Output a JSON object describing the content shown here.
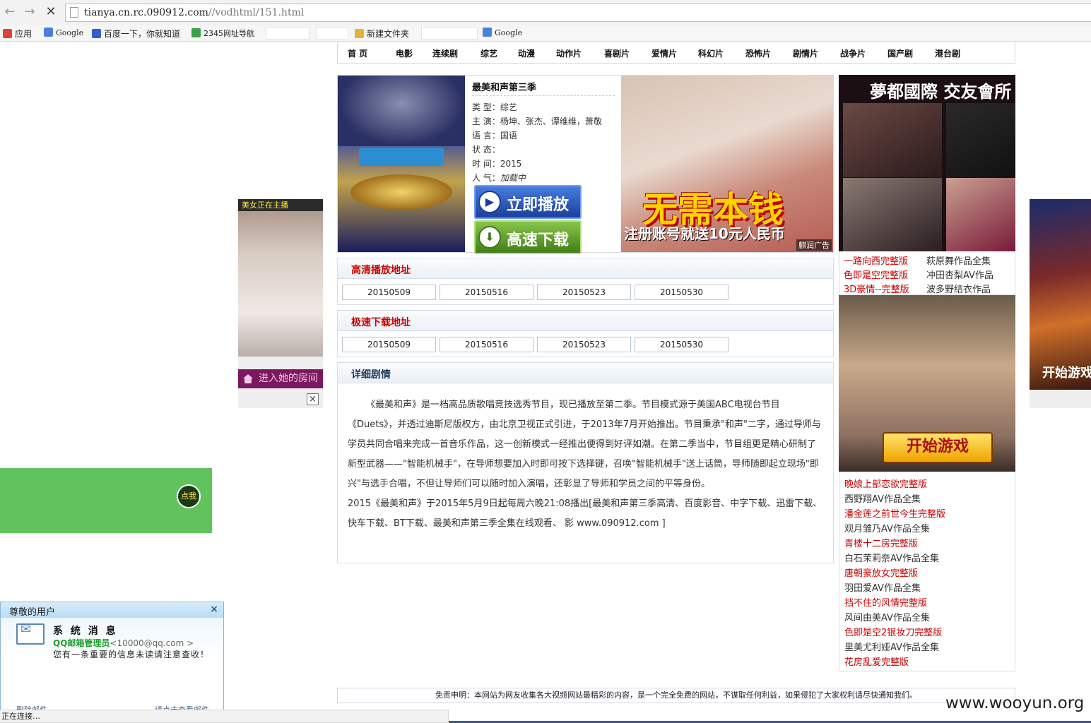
{
  "browser": {
    "url_host": "tianya.cn.rc.090912.com",
    "url_path": "//vodhtml/151.html",
    "bookmarks": [
      {
        "label": "应用",
        "color": "#d9453a"
      },
      {
        "label": "Google",
        "color": "#4a7fe0"
      },
      {
        "label": "百度一下，你就知道",
        "color": "#2f5fd0"
      },
      {
        "label": "2345网址导航",
        "color": "#3aa14a"
      },
      {
        "label": "新建文件夹",
        "color": "#e2b23a"
      },
      {
        "label": "Google",
        "color": "#4a7fe0"
      }
    ],
    "status": "正在连接…"
  },
  "nav": [
    "首 页",
    "电影",
    "连续剧",
    "综艺",
    "动漫",
    "动作片",
    "喜剧片",
    "爱情片",
    "科幻片",
    "恐怖片",
    "剧情片",
    "战争片",
    "国产剧",
    "港台剧"
  ],
  "show": {
    "title": "最美和声第三季",
    "type_label": "类 型：",
    "type": "综艺",
    "cast_label": "主 演：",
    "cast": "杨坤、张杰、谭维维，萧敬",
    "lang_label": "语 言：",
    "lang": "国语",
    "state_label": "状 态：",
    "state": "",
    "time_label": "时 间：",
    "time": "2015",
    "pop_label": "人 气：",
    "pop": "加载中",
    "play_btn": "立即播放",
    "download_btn": "高速下载"
  },
  "ad_main": {
    "headline": "无需本钱",
    "sub": "注册账号就送10元人民币",
    "tag": "麒润广告"
  },
  "play_section": {
    "title": "高清播放地址",
    "episodes": [
      "20150509",
      "20150516",
      "20150523",
      "20150530"
    ]
  },
  "download_section": {
    "title": "极速下载地址",
    "episodes": [
      "20150509",
      "20150516",
      "20150523",
      "20150530"
    ]
  },
  "detail": {
    "title": "详细剧情",
    "para1": "《最美和声》是一档高品质歌唱竞技选秀节目，现已播放至第二季。节目模式源于美国ABC电视台节目《Duets》，并透过迪斯尼版权方，由北京卫视正式引进，于2013年7月开始推出。节目秉承\"和声\"二字，通过导师与学员共同合唱来完成一首音乐作品，这一创新模式一经推出便得到好评如潮。在第二季当中，节目组更是精心研制了新型武器——\"智能机械手\"，在导师想要加入时即可按下选择键，召唤\"智能机械手\"送上话筒，导师随即起立现场\"即兴\"与选手合唱，不但让导师们可以随时加入演唱，还彰显了导师和学员之间的平等身份。",
    "para2": "2015《最美和声》于2015年5月9日起每周六晚21:08播出[最美和声第三季高清、百度影音、中字下载、迅雷下载、快车下载、BT下载、最美和声第三季全集在线观看、 影 www.090912.com ]"
  },
  "right_ad1": {
    "headline": "夢都國際 交友會所"
  },
  "right_links": [
    {
      "text": "一路向西完整版",
      "red": true
    },
    {
      "text": "萩原舞作品全集",
      "red": false
    },
    {
      "text": "色即是空完整版",
      "red": true
    },
    {
      "text": "冲田杏梨AV作品",
      "red": false
    },
    {
      "text": "3D豪情--完整版",
      "red": true
    },
    {
      "text": "波多野结衣作品",
      "red": false
    }
  ],
  "right_ad2": {
    "button": "开始游戏"
  },
  "right_list": [
    {
      "text": "晚娘上部恋欲完整版",
      "red": true
    },
    {
      "text": "西野翔AV作品全集",
      "red": false
    },
    {
      "text": "潘金莲之前世今生完整版",
      "red": true
    },
    {
      "text": "观月雏乃AV作品全集",
      "red": false
    },
    {
      "text": "青楼十二房完整版",
      "red": true
    },
    {
      "text": "白石茉莉奈AV作品全集",
      "red": false
    },
    {
      "text": "唐朝豪放女完整版",
      "red": true
    },
    {
      "text": "羽田爱AV作品全集",
      "red": false
    },
    {
      "text": "挡不住的风情完整版",
      "red": true
    },
    {
      "text": "风间由美AV作品全集",
      "red": false
    },
    {
      "text": "色即是空2银妆刀完整版",
      "red": true
    },
    {
      "text": "里美尤利娅AV作品全集",
      "red": false
    },
    {
      "text": "花房乱爱完整版",
      "red": true
    }
  ],
  "left_float": {
    "header": "美女正在主播",
    "room_btn": "进入她的房间",
    "close": "×"
  },
  "green_bar": {
    "button": "点我"
  },
  "right_float": {
    "caption": "开始游戏"
  },
  "qq_popup": {
    "title": "尊敬的用户",
    "close": "×",
    "system": "系 统 消 息",
    "sender_name": "QQ邮箱管理员",
    "sender_addr": "<10000@qq.com >",
    "message": "您有一条重要的信息未读请注意查收！",
    "foot_left": "删除邮件",
    "foot_right": "请点击查看邮件"
  },
  "footer": "免责申明：本网站为网友收集各大视频网站最精彩的内容，是一个完全免费的网站，不谋取任何利益，如果侵犯了大家权利请尽快通知我们。",
  "watermark": "www.wooyun.org"
}
